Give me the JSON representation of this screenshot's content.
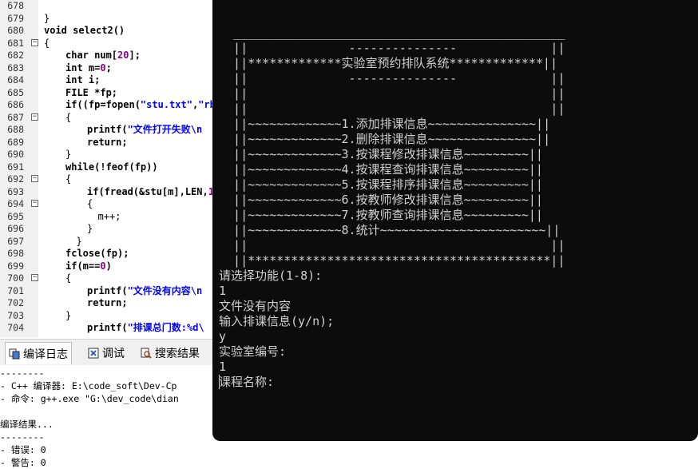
{
  "editor": {
    "lines": [
      {
        "no": "678",
        "fold": "",
        "indent": 1,
        "code": ""
      },
      {
        "no": "679",
        "fold": "",
        "indent": 0,
        "code": "}"
      },
      {
        "no": "680",
        "fold": "",
        "indent": 0,
        "code": "void select2()"
      },
      {
        "no": "681",
        "fold": "−",
        "indent": 0,
        "code": "{"
      },
      {
        "no": "682",
        "fold": "",
        "indent": 2,
        "code": "char num[20];"
      },
      {
        "no": "683",
        "fold": "",
        "indent": 2,
        "code": "int m=0;"
      },
      {
        "no": "684",
        "fold": "",
        "indent": 2,
        "code": "int i;"
      },
      {
        "no": "685",
        "fold": "",
        "indent": 2,
        "code": "FILE *fp;"
      },
      {
        "no": "686",
        "fold": "",
        "indent": 2,
        "code": "if((fp=fopen(\"stu.txt\",\"rb"
      },
      {
        "no": "687",
        "fold": "−",
        "indent": 2,
        "code": "{"
      },
      {
        "no": "688",
        "fold": "",
        "indent": 4,
        "code": "printf(\"文件打开失败\\n"
      },
      {
        "no": "689",
        "fold": "",
        "indent": 4,
        "code": "return;"
      },
      {
        "no": "690",
        "fold": "",
        "indent": 2,
        "code": "}"
      },
      {
        "no": "691",
        "fold": "",
        "indent": 2,
        "code": "while(!feof(fp))"
      },
      {
        "no": "692",
        "fold": "−",
        "indent": 2,
        "code": "{"
      },
      {
        "no": "693",
        "fold": "",
        "indent": 4,
        "code": "if(fread(&stu[m],LEN,1"
      },
      {
        "no": "694",
        "fold": "−",
        "indent": 4,
        "code": "{"
      },
      {
        "no": "695",
        "fold": "",
        "indent": 5,
        "code": "m++;"
      },
      {
        "no": "696",
        "fold": "",
        "indent": 4,
        "code": "}"
      },
      {
        "no": "697",
        "fold": "",
        "indent": 3,
        "code": "}"
      },
      {
        "no": "698",
        "fold": "",
        "indent": 2,
        "code": "fclose(fp);"
      },
      {
        "no": "699",
        "fold": "",
        "indent": 2,
        "code": "if(m==0)"
      },
      {
        "no": "700",
        "fold": "−",
        "indent": 2,
        "code": "{"
      },
      {
        "no": "701",
        "fold": "",
        "indent": 4,
        "code": "printf(\"文件没有内容\\n"
      },
      {
        "no": "702",
        "fold": "",
        "indent": 4,
        "code": "return;"
      },
      {
        "no": "703",
        "fold": "",
        "indent": 2,
        "code": "}"
      },
      {
        "no": "704",
        "fold": "",
        "indent": 4,
        "code": "printf(\"排课总门数:%d\\"
      }
    ]
  },
  "tabs": [
    {
      "label": "编译日志",
      "icon": "compile-log-icon"
    },
    {
      "label": "调试",
      "icon": "debug-icon"
    },
    {
      "label": "搜索结果",
      "icon": "search-results-icon"
    }
  ],
  "log": [
    "--------",
    "- C++ 编译器: E:\\code_soft\\Dev-Cp",
    "- 命令: g++.exe \"G:\\dev_code\\dian",
    "",
    "编译结果...",
    "--------",
    "- 错误: 0",
    "- 警告: 0"
  ],
  "console": {
    "lines": [
      "",
      "  ______________________________________________",
      "  ||              ---------------             ||",
      "  ||*************实验室预约排队系统*************||",
      "  ||              ---------------             ||",
      "  ||                                          ||",
      "  ||                                          ||",
      "  ||~~~~~~~~~~~~~1.添加排课信息~~~~~~~~~~~~~~~||",
      "  ||~~~~~~~~~~~~~2.删除排课信息~~~~~~~~~~~~~~~||",
      "  ||~~~~~~~~~~~~~3.按课程修改排课信息~~~~~~~~~||",
      "  ||~~~~~~~~~~~~~4.按课程查询排课信息~~~~~~~~~||",
      "  ||~~~~~~~~~~~~~5.按课程排序排课信息~~~~~~~~~||",
      "  ||~~~~~~~~~~~~~6.按教师修改排课信息~~~~~~~~~||",
      "  ||~~~~~~~~~~~~~7.按教师查询排课信息~~~~~~~~~||",
      "  ||~~~~~~~~~~~~~8.统计~~~~~~~~~~~~~~~~~~~~~~~||",
      "  ||                                          ||",
      "  ||******************************************||",
      "请选择功能(1-8):",
      "1",
      "文件没有内容",
      "输入排课信息(y/n);",
      "y",
      "实验室编号:",
      "1",
      "课程名称:"
    ]
  },
  "colors": {
    "console_bg": "#0c0c0c",
    "console_text": "#d0d0d0",
    "string_blue": "#0000ff",
    "number_purple": "#8b008b"
  }
}
